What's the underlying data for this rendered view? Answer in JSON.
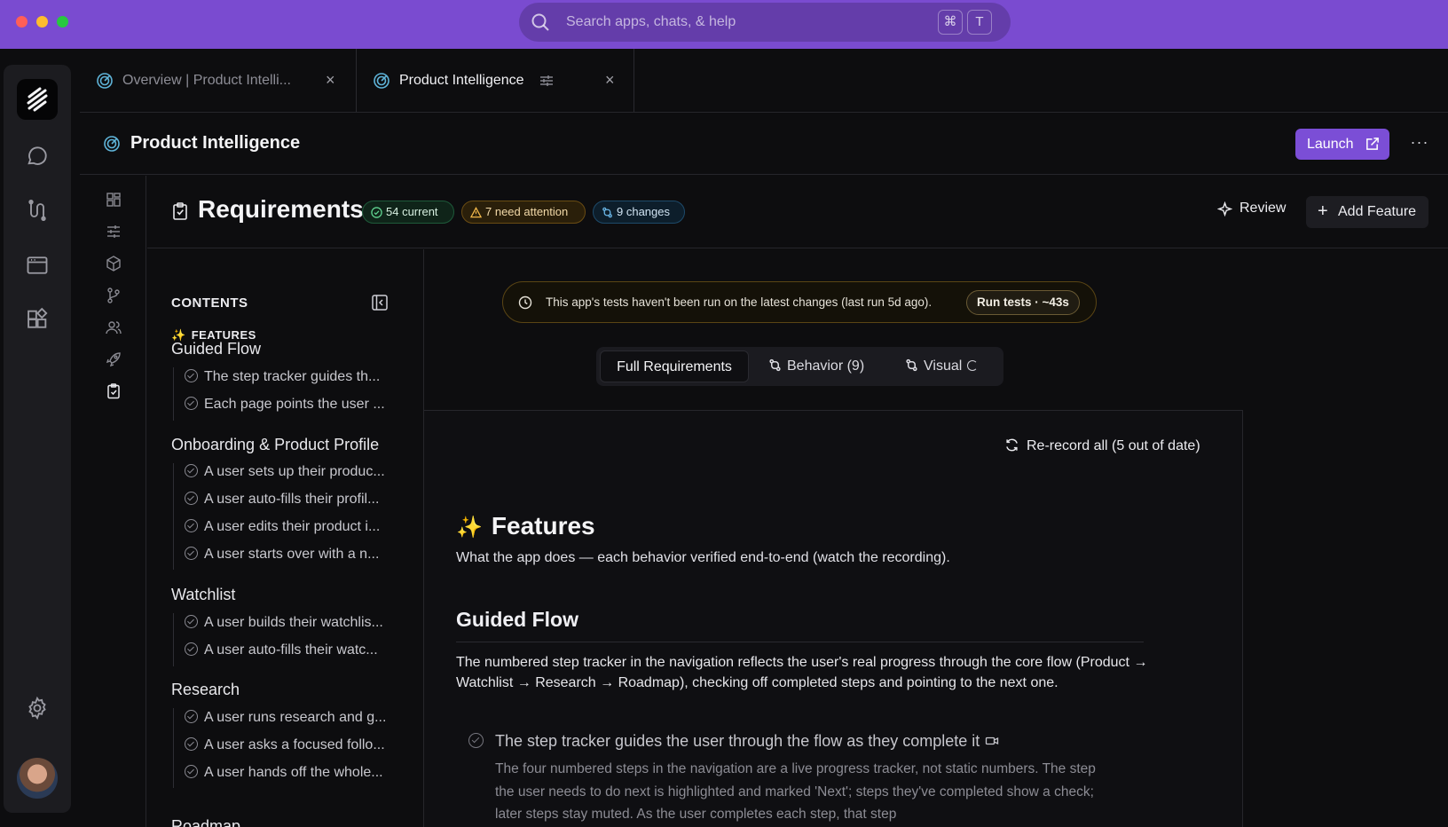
{
  "titlebar": {
    "search_placeholder": "Search apps, chats, & help",
    "shortcut_keys": [
      "⌘",
      "T"
    ]
  },
  "tabs": [
    {
      "label": "Overview | Product Intelli...",
      "close": "×",
      "active": false
    },
    {
      "label": "Product Intelligence",
      "close": "×",
      "active": true
    }
  ],
  "app_header": {
    "title": "Product Intelligence",
    "launch_label": "Launch",
    "more_label": "···"
  },
  "page": {
    "title": "Requirements",
    "badges": {
      "current": "54 current",
      "attention": "7 need attention",
      "changes": "9 changes"
    },
    "review_label": "Review",
    "add_feature_label": "Add Feature"
  },
  "toc": {
    "heading": "CONTENTS",
    "features_label": "FEATURES",
    "sections": [
      {
        "title": "Guided Flow",
        "items": [
          "The step tracker guides th...",
          "Each page points the user ..."
        ]
      },
      {
        "title": "Onboarding & Product Profile",
        "items": [
          "A user sets up their produc...",
          "A user auto-fills their profil...",
          "A user edits their product i...",
          "A user starts over with a n..."
        ]
      },
      {
        "title": "Watchlist",
        "items": [
          "A user builds their watchlis...",
          "A user auto-fills their watc..."
        ]
      },
      {
        "title": "Research",
        "items": [
          "A user runs research and g...",
          "A user asks a focused follo...",
          "A user hands off the whole..."
        ]
      },
      {
        "title": "Roadmap",
        "items": []
      }
    ]
  },
  "banner": {
    "text": "This app's tests haven't been run on the latest changes (last run 5d ago).",
    "run_tests_label": "Run tests · ~43s"
  },
  "view_tabs": {
    "full": "Full Requirements",
    "behavior": "Behavior (9)",
    "visual": "Visual"
  },
  "content": {
    "rerecord_label": "Re-record all (5 out of date)",
    "features_title": "Features",
    "features_desc": "What the app does — each behavior verified end-to-end (watch the recording).",
    "guided_flow_title": "Guided Flow",
    "guided_flow_desc": "The numbered step tracker in the navigation reflects the user's real progress through the core flow (Product → Watchlist → Research → Roadmap), checking off completed steps and pointing to the next one.",
    "behavior_title": "The step tracker guides the user through the flow as they complete it",
    "behavior_desc": "The four numbered steps in the navigation are a live progress tracker, not static numbers. The step the user needs to do next is highlighted and marked 'Next'; steps they've completed show a check; later steps stay muted. As the user completes each step, that step"
  },
  "colors": {
    "titlebar": "#7a4bd0",
    "accent": "#7b4ed6",
    "background": "#0d0d0f",
    "success": "#1e5a3a",
    "warning": "#6a4c13",
    "info": "#1d4a6a"
  }
}
